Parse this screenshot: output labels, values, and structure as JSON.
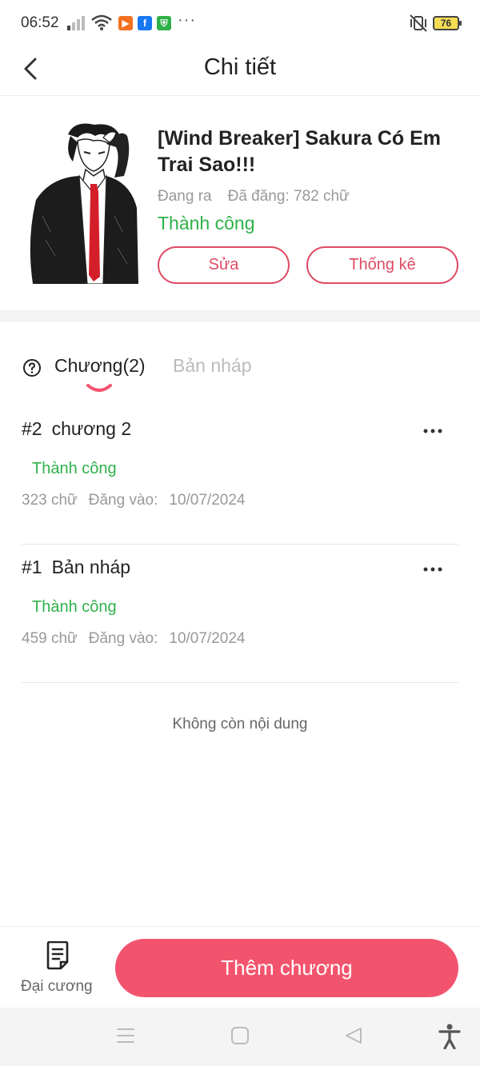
{
  "status_bar": {
    "time": "06:52",
    "apps": [
      {
        "icon": "play-app-icon",
        "glyph": "▶",
        "color": "#f37021"
      },
      {
        "icon": "facebook-icon",
        "glyph": "f",
        "color": "#1877f2"
      },
      {
        "icon": "vpn-shield-icon",
        "glyph": "⛨",
        "color": "#2fb14a"
      }
    ],
    "more": "···",
    "battery": "76"
  },
  "header": {
    "title": "Chi tiết",
    "back_icon": "chevron-left-icon"
  },
  "story": {
    "title": "[Wind Breaker] Sakura Có Em Trai Sao!!!",
    "status": "Đang ra",
    "word_count": "Đã đăng: 782 chữ",
    "review_status": "Thành công",
    "edit_label": "Sửa",
    "stats_label": "Thống kê"
  },
  "tabs": {
    "chapters_label": "Chương(2)",
    "drafts_label": "Bản nháp"
  },
  "chapters": [
    {
      "number": "#2",
      "title": "chương 2",
      "status": "Thành công",
      "words": "323 chữ",
      "posted_label": "Đăng vào:",
      "date": "10/07/2024"
    },
    {
      "number": "#1",
      "title": "Bản nháp",
      "status": "Thành công",
      "words": "459 chữ",
      "posted_label": "Đăng vào:",
      "date": "10/07/2024"
    }
  ],
  "end_text": "Không còn nội dung",
  "bottom_bar": {
    "outline_label": "Đại cương",
    "add_chapter_label": "Thêm chương"
  },
  "colors": {
    "accent": "#f3546d",
    "outline_accent": "#de4b64",
    "success": "#2fb14a"
  }
}
